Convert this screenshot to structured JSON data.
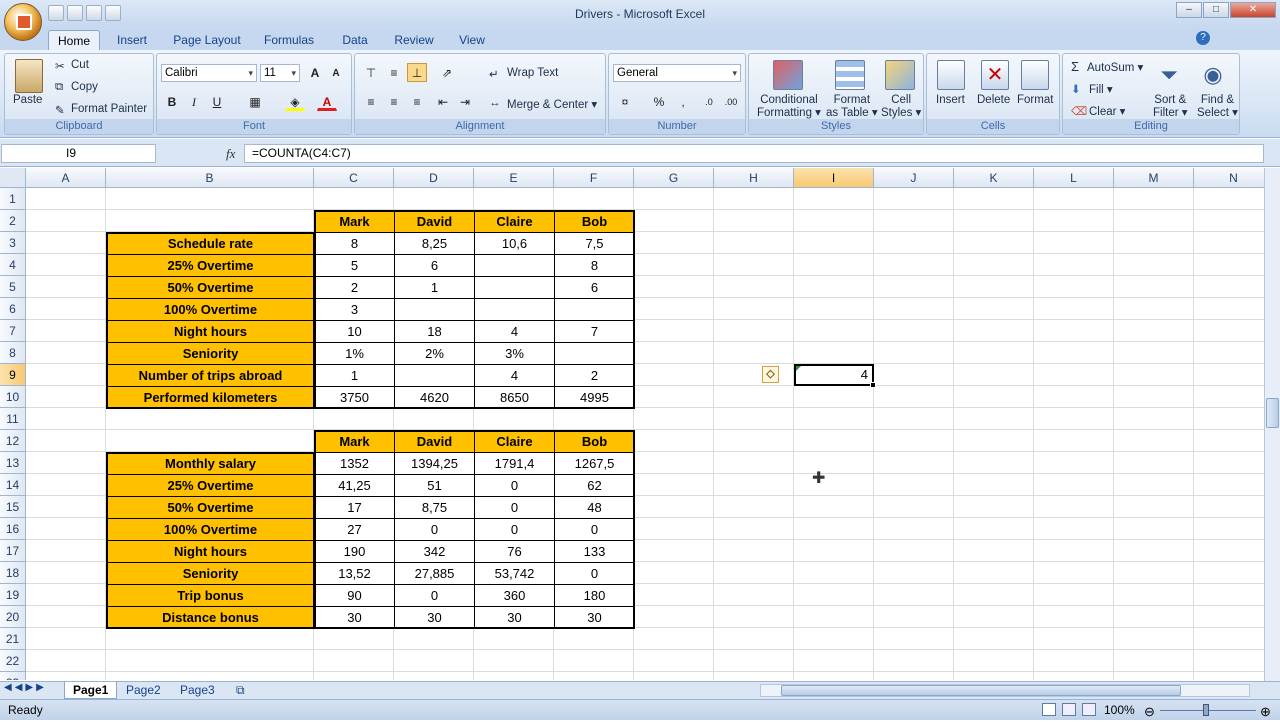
{
  "window": {
    "title": "Drivers - Microsoft Excel"
  },
  "tabs": [
    "Home",
    "Insert",
    "Page Layout",
    "Formulas",
    "Data",
    "Review",
    "View"
  ],
  "ribbon": {
    "clipboard": {
      "paste": "Paste",
      "cut": "Cut",
      "copy": "Copy",
      "format_painter": "Format Painter",
      "label": "Clipboard"
    },
    "font": {
      "family": "Calibri",
      "size": "11",
      "label": "Font"
    },
    "alignment": {
      "wrap": "Wrap Text",
      "merge": "Merge & Center",
      "label": "Alignment"
    },
    "number": {
      "format": "General",
      "label": "Number"
    },
    "styles": {
      "cond": "Conditional",
      "cond2": "Formatting",
      "table": "Format",
      "table2": "as Table",
      "cell": "Cell",
      "cell2": "Styles",
      "label": "Styles"
    },
    "cells": {
      "insert": "Insert",
      "delete": "Delete",
      "format": "Format",
      "label": "Cells"
    },
    "editing": {
      "autosum": "AutoSum",
      "fill": "Fill",
      "clear": "Clear",
      "sort": "Sort &",
      "sort2": "Filter",
      "find": "Find &",
      "find2": "Select",
      "label": "Editing"
    }
  },
  "formula_bar": {
    "name_box": "I9",
    "fx": "fx",
    "formula": "=COUNTA(C4:C7)"
  },
  "columns": [
    "A",
    "B",
    "C",
    "D",
    "E",
    "F",
    "G",
    "H",
    "I",
    "J",
    "K",
    "L",
    "M",
    "N"
  ],
  "rows": [
    "1",
    "2",
    "3",
    "4",
    "5",
    "6",
    "7",
    "8",
    "9",
    "10",
    "11",
    "12",
    "13",
    "14",
    "15",
    "16",
    "17",
    "18",
    "19",
    "20",
    "21",
    "22",
    "23"
  ],
  "table1": {
    "headers": [
      "Mark",
      "David",
      "Claire",
      "Bob"
    ],
    "rows": [
      {
        "label": "Schedule rate",
        "values": [
          "8",
          "8,25",
          "10,6",
          "7,5"
        ]
      },
      {
        "label": "25% Overtime",
        "values": [
          "5",
          "6",
          "",
          "8"
        ]
      },
      {
        "label": "50% Overtime",
        "values": [
          "2",
          "1",
          "",
          "6"
        ]
      },
      {
        "label": "100% Overtime",
        "values": [
          "3",
          "",
          "",
          ""
        ]
      },
      {
        "label": "Night hours",
        "values": [
          "10",
          "18",
          "4",
          "7"
        ]
      },
      {
        "label": "Seniority",
        "values": [
          "1%",
          "2%",
          "3%",
          ""
        ]
      },
      {
        "label": "Number of trips abroad",
        "values": [
          "1",
          "",
          "4",
          "2"
        ]
      },
      {
        "label": "Performed kilometers",
        "values": [
          "3750",
          "4620",
          "8650",
          "4995"
        ]
      }
    ]
  },
  "table2": {
    "headers": [
      "Mark",
      "David",
      "Claire",
      "Bob"
    ],
    "rows": [
      {
        "label": "Monthly salary",
        "values": [
          "1352",
          "1394,25",
          "1791,4",
          "1267,5"
        ]
      },
      {
        "label": "25% Overtime",
        "values": [
          "41,25",
          "51",
          "0",
          "62"
        ]
      },
      {
        "label": "50% Overtime",
        "values": [
          "17",
          "8,75",
          "0",
          "48"
        ]
      },
      {
        "label": "100% Overtime",
        "values": [
          "27",
          "0",
          "0",
          "0"
        ]
      },
      {
        "label": "Night hours",
        "values": [
          "190",
          "342",
          "76",
          "133"
        ]
      },
      {
        "label": "Seniority",
        "values": [
          "13,52",
          "27,885",
          "53,742",
          "0"
        ]
      },
      {
        "label": "Trip bonus",
        "values": [
          "90",
          "0",
          "360",
          "180"
        ]
      },
      {
        "label": "Distance bonus",
        "values": [
          "30",
          "30",
          "30",
          "30"
        ]
      }
    ]
  },
  "selected_cell_value": "4",
  "sheets": [
    "Page1",
    "Page2",
    "Page3"
  ],
  "status": {
    "mode": "Ready",
    "zoom": "100%"
  }
}
